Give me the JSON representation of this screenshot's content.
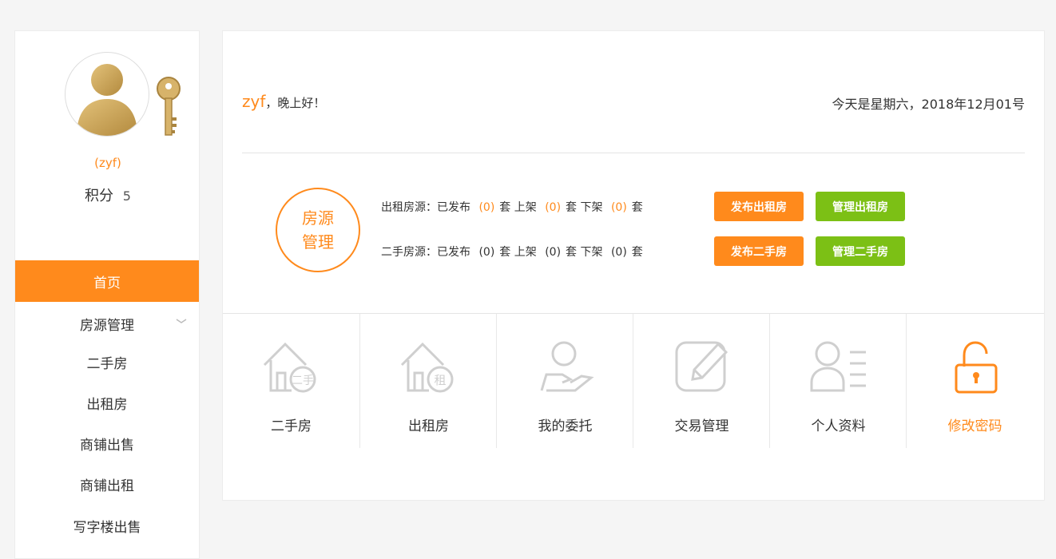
{
  "user": {
    "name": "(zyf)",
    "points_label": "积分",
    "points": "5"
  },
  "sidebar": {
    "active": "首页",
    "group": "房源管理",
    "items": [
      "二手房",
      "出租房",
      "商铺出售",
      "商铺出租",
      "写字楼出售"
    ]
  },
  "header": {
    "greet_name": "zyf",
    "greet_text": "，晚上好！",
    "date": "今天是星期六，2018年12月01号"
  },
  "house": {
    "badge_line1": "房源",
    "badge_line2": "管理",
    "rent": {
      "label": "出租房源：已发布",
      "published": "(0)",
      "unit1": "套 上架",
      "listed": "(0)",
      "unit2": "套 下架",
      "delisted": "(0)",
      "unit3": "套"
    },
    "second": {
      "label": "二手房源：已发布",
      "published": "(0)",
      "unit1": "套 上架",
      "listed": "(0)",
      "unit2": "套 下架",
      "delisted": "(0)",
      "unit3": "套"
    },
    "buttons": {
      "publish_rent": "发布出租房",
      "manage_rent": "管理出租房",
      "publish_second": "发布二手房",
      "manage_second": "管理二手房"
    }
  },
  "tiles": [
    {
      "label": "二手房",
      "icon": "house-second-icon",
      "badge": "二手"
    },
    {
      "label": "出租房",
      "icon": "house-rent-icon",
      "badge": "租"
    },
    {
      "label": "我的委托",
      "icon": "entrust-icon"
    },
    {
      "label": "交易管理",
      "icon": "edit-icon"
    },
    {
      "label": "个人资料",
      "icon": "profile-icon"
    },
    {
      "label": "修改密码",
      "icon": "lock-icon"
    }
  ],
  "colors": {
    "accent": "#ff8a1c",
    "green": "#7cc015",
    "icon_gray": "#cfcfcf"
  }
}
